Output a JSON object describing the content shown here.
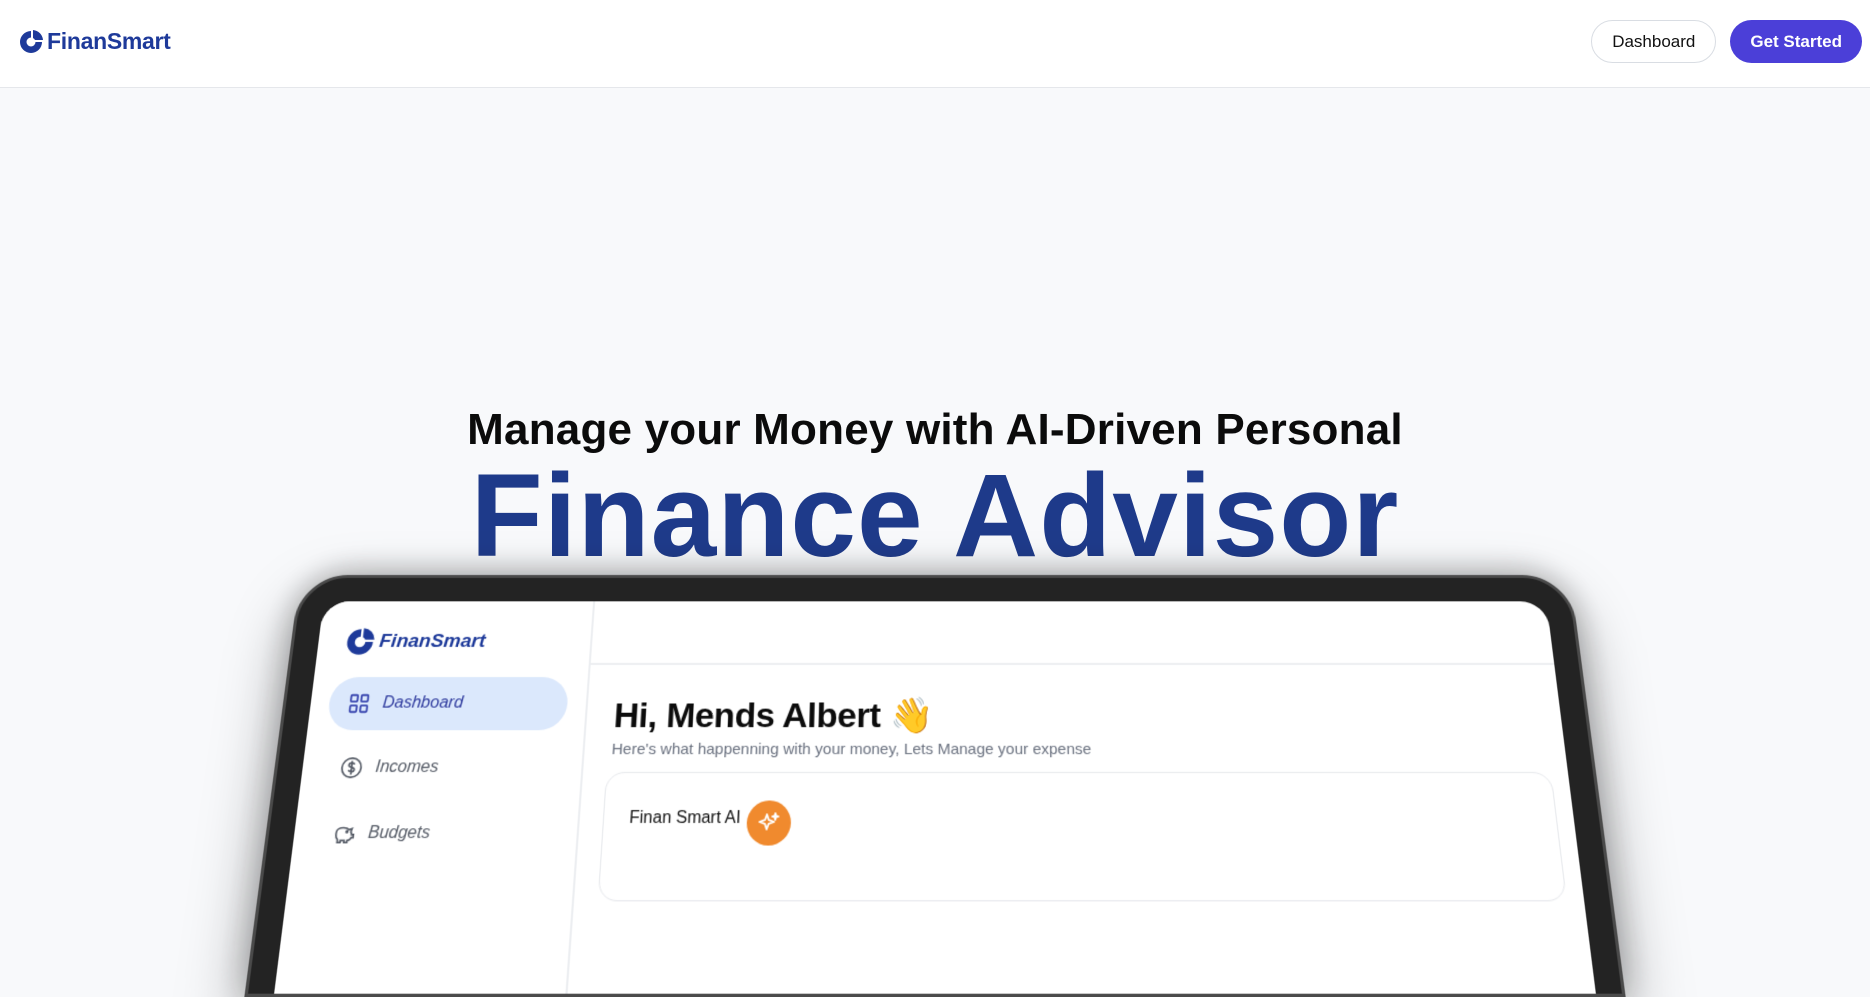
{
  "navbar": {
    "brand": "FinanSmart",
    "dashboard_label": "Dashboard",
    "get_started_label": "Get Started"
  },
  "hero": {
    "subtitle": "Manage your Money with AI-Driven Personal",
    "title": "Finance Advisor"
  },
  "preview": {
    "brand": "FinanSmart",
    "sidebar": {
      "items": [
        {
          "label": "Dashboard",
          "icon": "grid-icon",
          "active": true
        },
        {
          "label": "Incomes",
          "icon": "dollar-circle-icon",
          "active": false
        },
        {
          "label": "Budgets",
          "icon": "piggy-bank-icon",
          "active": false
        }
      ]
    },
    "greeting": "Hi, Mends Albert 👋",
    "greeting_sub": "Here's what happenning with your money, Lets Manage your expense",
    "ai_card": {
      "label": "Finan Smart AI",
      "icon": "sparkles-icon"
    }
  },
  "colors": {
    "brand": "#1e3a9a",
    "primary_button": "#4b3fd8",
    "hero_title": "#1e3a8a",
    "active_nav_bg": "#dbe8fc",
    "ai_badge": "#f08a2e"
  }
}
